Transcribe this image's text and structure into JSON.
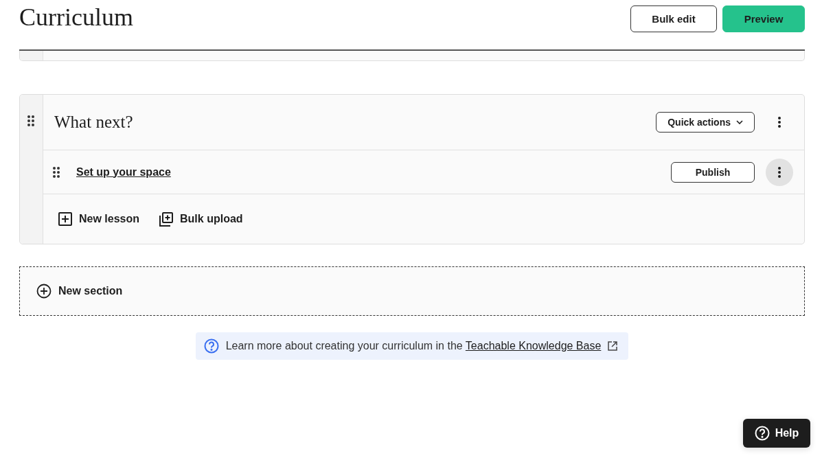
{
  "page": {
    "title": "Curriculum",
    "buttons": [
      {
        "label": "Bulk edit",
        "kind": "outline"
      },
      {
        "label": "Preview",
        "kind": "primary"
      }
    ]
  },
  "sections": [
    {
      "title": "What next?",
      "quick_actions": "Quick actions",
      "lessons": [
        {
          "title": "Set up your space",
          "action": "Publish",
          "menu_hovered": true
        }
      ],
      "add_actions": [
        {
          "label": "New lesson",
          "kind": "new"
        },
        {
          "label": "Bulk upload",
          "kind": "bulk"
        }
      ]
    }
  ],
  "new_section": "New section",
  "info": {
    "text": "Learn more about creating your curriculum in the ",
    "link": "Teachable Knowledge Base"
  },
  "help": "Help"
}
